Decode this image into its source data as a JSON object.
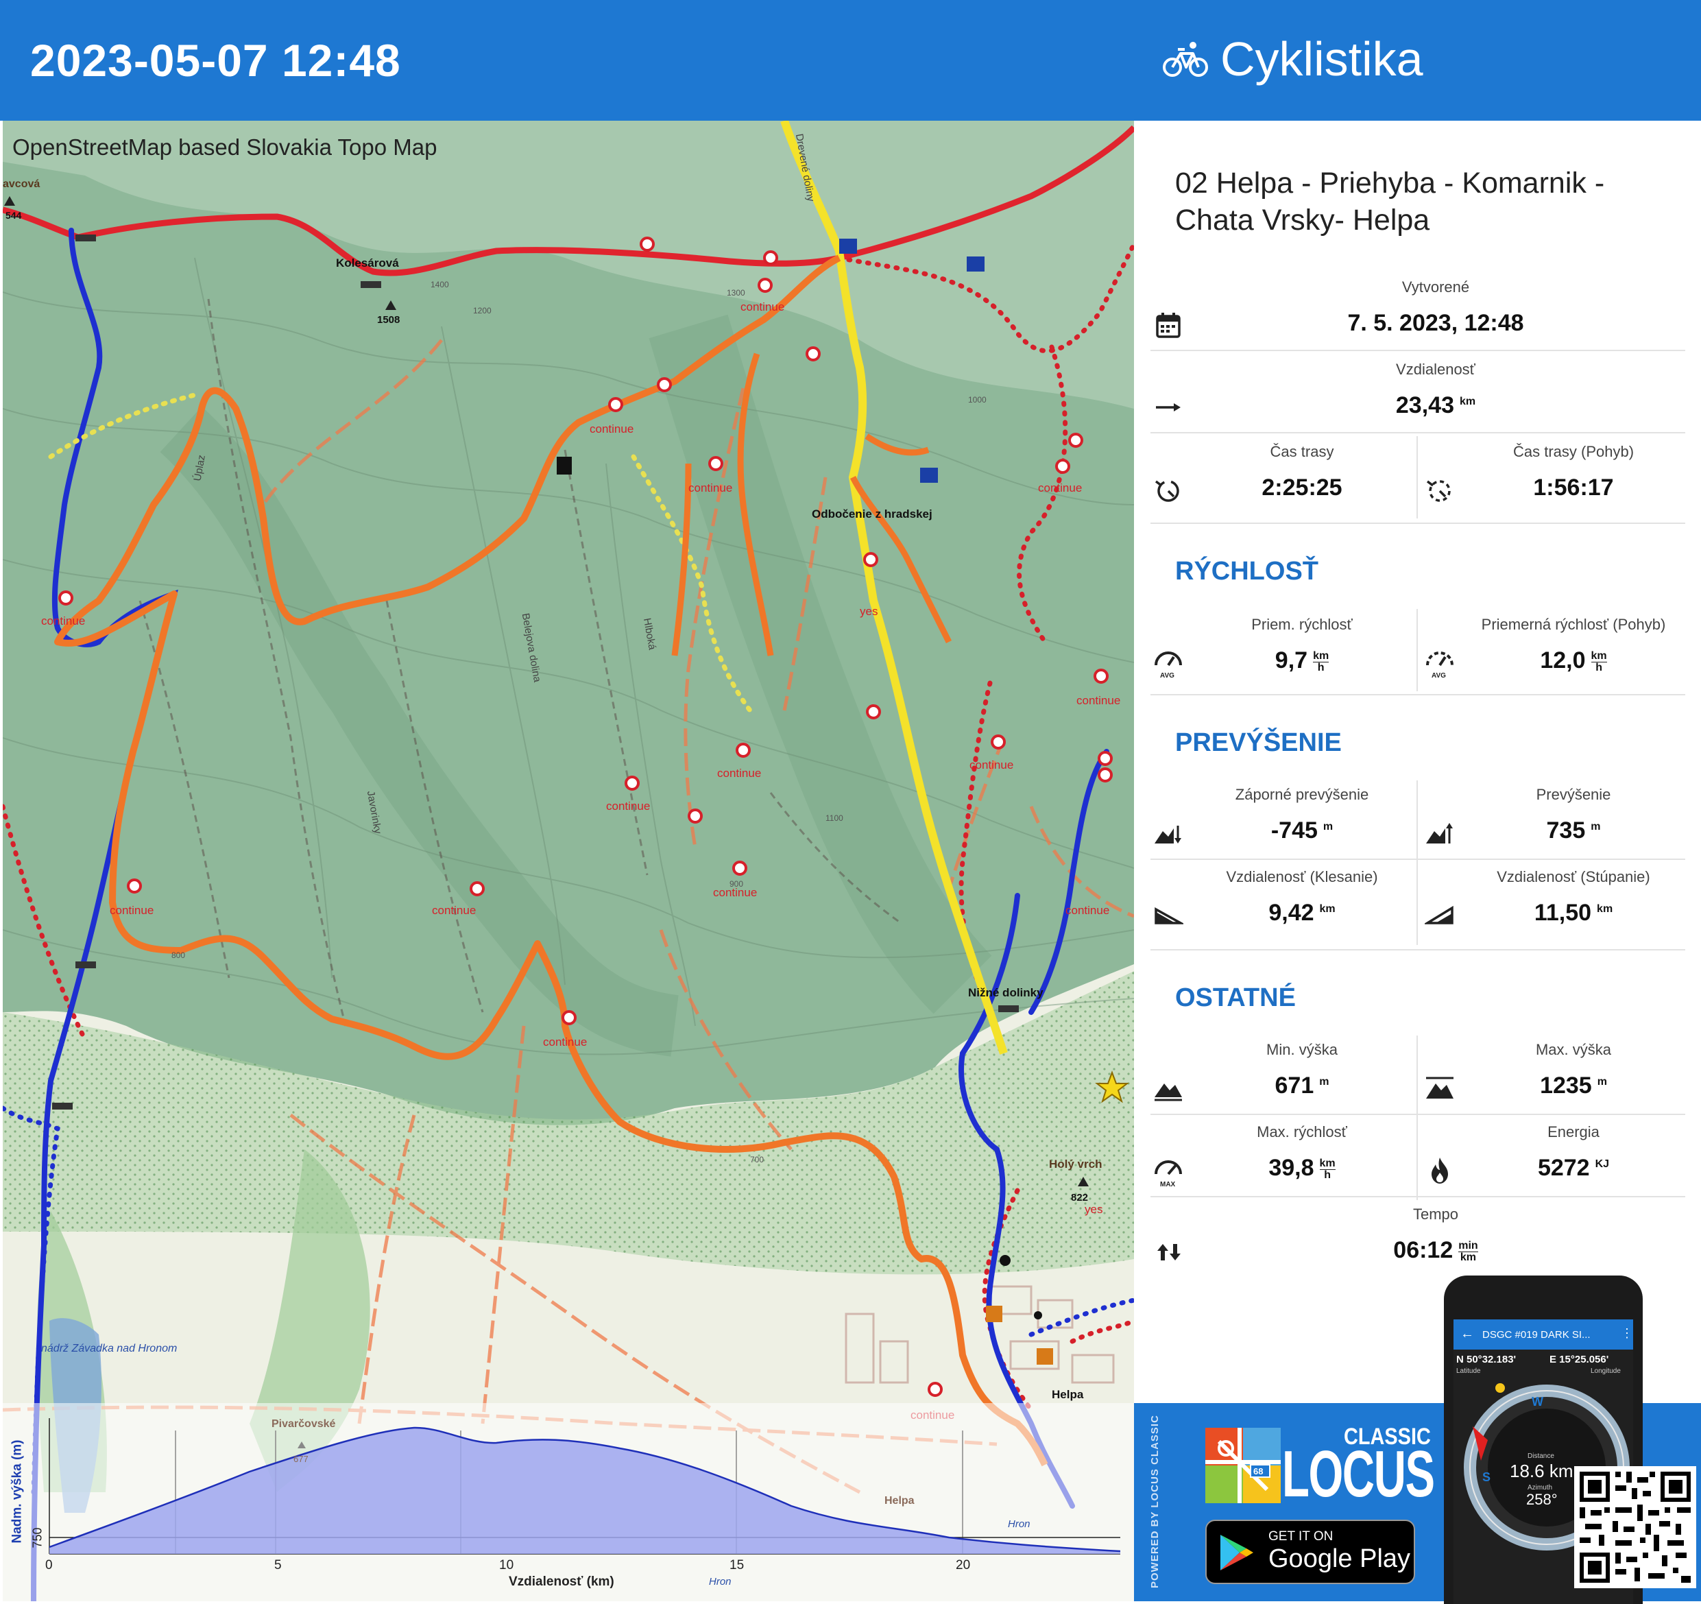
{
  "header": {
    "datetime": "2023-05-07 12:48",
    "activity": "Cyklistika",
    "activity_icon": "bicycle-icon"
  },
  "map": {
    "source": "OpenStreetMap based Slovakia Topo Map",
    "labels": {
      "kolesarova": "Kolesárová",
      "kolesarova_ele": "1508",
      "odbocenie": "Odbočenie z hradskej",
      "nizne": "Nižné dolinky",
      "holy": "Holý vrch",
      "holy_ele": "822",
      "helpa": "Helpa",
      "yes": "yes",
      "reservoir": "nádrž Závadka nad Hronom",
      "left_top": "avcová",
      "left_ele": "544",
      "pivarcovske": "Pivarčovské",
      "pivarcovske_ele": "677",
      "upaz": "Úplaz",
      "belejova": "Belejova dolina",
      "hlboka": "Hlboká",
      "javorinky": "Javorinky",
      "hron": "Hron",
      "drevene": "Drevené doliny"
    },
    "continue_label": "continue",
    "contours": [
      "1400",
      "1300",
      "1200",
      "1100",
      "1000",
      "900",
      "800",
      "700"
    ]
  },
  "track": {
    "name": "02 Helpa - Priehyba - Komarnik - Chata Vrsky- Helpa"
  },
  "stats": {
    "created_label": "Vytvorené",
    "created_value": "7. 5. 2023, 12:48",
    "distance_label": "Vzdialenosť",
    "distance_value": "23,43",
    "distance_unit": "km",
    "time_label": "Čas trasy",
    "time_value": "2:25:25",
    "time_moving_label": "Čas trasy (Pohyb)",
    "time_moving_value": "1:56:17"
  },
  "speed": {
    "title": "RÝCHLOSŤ",
    "avg_label": "Priem. rýchlosť",
    "avg_value": "9,7",
    "avg_moving_label": "Priemerná rýchlosť (Pohyb)",
    "avg_moving_value": "12,0",
    "unit_top": "km",
    "unit_bottom": "h"
  },
  "elevation": {
    "title": "PREVÝŠENIE",
    "neg_label": "Záporné prevýšenie",
    "neg_value": "-745",
    "pos_label": "Prevýšenie",
    "pos_value": "735",
    "m": "m",
    "down_dist_label": "Vzdialenosť (Klesanie)",
    "down_dist_value": "9,42",
    "up_dist_label": "Vzdialenosť (Stúpanie)",
    "up_dist_value": "11,50",
    "km": "km"
  },
  "other": {
    "title": "OSTATNÉ",
    "min_label": "Min. výška",
    "min_value": "671",
    "max_label": "Max. výška",
    "max_value": "1235",
    "maxspeed_label": "Max. rýchlosť",
    "maxspeed_value": "39,8",
    "energy_label": "Energia",
    "energy_value": "5272",
    "energy_unit": "KJ",
    "tempo_label": "Tempo",
    "tempo_value": "06:12",
    "tempo_unit_top": "min",
    "tempo_unit_bottom": "km",
    "avg_badge": "AVG",
    "max_badge": "MAX"
  },
  "profile": {
    "ylabel": "Nadm. výška (m)",
    "xlabel": "Vzdialenosť (km)",
    "y_tick": "750",
    "x_ticks": [
      "0",
      "5",
      "10",
      "15",
      "20"
    ]
  },
  "promo": {
    "powered": "POWERED BY LOCUS CLASSIC",
    "classic": "CLASSIC",
    "locus": "LOCUS",
    "get_it_on": "GET IT ON",
    "store": "Google Play",
    "phone_title": "DSGC #019 DARK SI...",
    "lat_value": "N 50°32.183'",
    "lat_label": "Latitude",
    "lon_value": "E 15°25.056'",
    "lon_label": "Longitude",
    "distance_label": "Distance",
    "distance_value": "18.6 km",
    "azimuth_label": "Azimuth",
    "azimuth_value": "258°",
    "badge": "68"
  }
}
